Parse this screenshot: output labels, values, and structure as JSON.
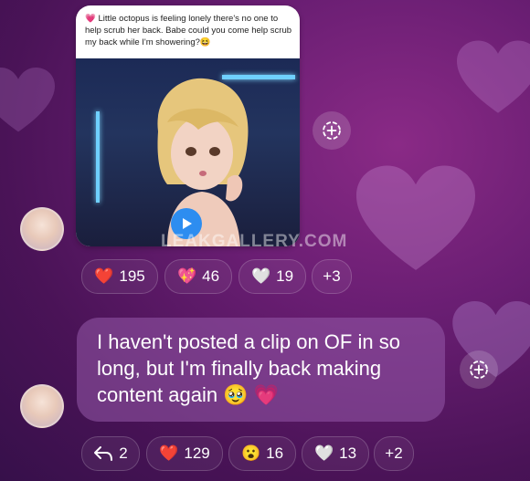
{
  "post": {
    "caption": "💗 Little octopus is feeling lonely there's no one to help scrub her back. Babe could you come help scrub my back while I'm showering?😆"
  },
  "watermark": "LEAKGALLERY.COM",
  "post_reactions": [
    {
      "icon": "red-heart-icon",
      "emoji": "❤️",
      "count": "195"
    },
    {
      "icon": "sparkling-heart-icon",
      "emoji": "💖",
      "count": "46"
    },
    {
      "icon": "white-heart-icon",
      "emoji": "🤍",
      "count": "19"
    },
    {
      "icon": "more-reactions",
      "emoji": "",
      "count": "+3"
    }
  ],
  "message": {
    "text": "I haven't posted a clip on OF in so long, but I'm finally back making content again 🥹 💗"
  },
  "message_reactions": [
    {
      "icon": "reply-icon",
      "emoji": "⮪",
      "count": "2"
    },
    {
      "icon": "red-heart-icon",
      "emoji": "❤️",
      "count": "129"
    },
    {
      "icon": "surprised-face-icon",
      "emoji": "😮",
      "count": "16"
    },
    {
      "icon": "white-heart-icon",
      "emoji": "🤍",
      "count": "13"
    },
    {
      "icon": "more-reactions",
      "emoji": "",
      "count": "+2"
    }
  ],
  "colors": {
    "background": "#5a1865",
    "play_button": "#2d8df0",
    "bubble": "#9a5aaa"
  }
}
